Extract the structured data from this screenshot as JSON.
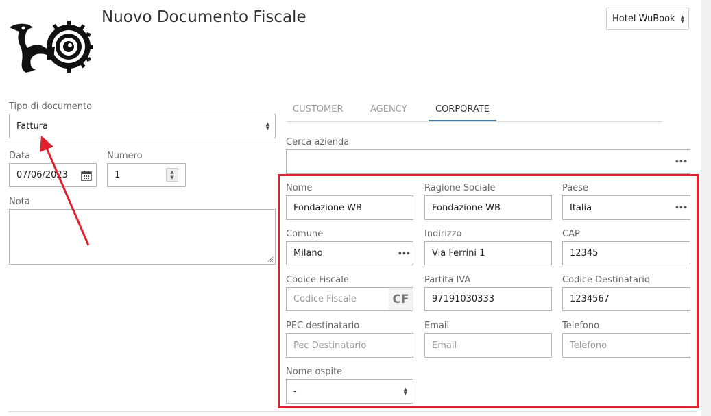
{
  "header": {
    "title": "Nuovo Documento Fiscale",
    "hotel_select": "Hotel WuBook"
  },
  "left": {
    "tipo_label": "Tipo di documento",
    "tipo_value": "Fattura",
    "data_label": "Data",
    "data_value": "07/06/2023",
    "numero_label": "Numero",
    "numero_value": "1",
    "nota_label": "Nota"
  },
  "tabs": [
    "CUSTOMER",
    "AGENCY",
    "CORPORATE"
  ],
  "active_tab": "CORPORATE",
  "search": {
    "label": "Cerca azienda"
  },
  "form": {
    "nome_label": "Nome",
    "nome_value": "Fondazione WB",
    "ragione_label": "Ragione Sociale",
    "ragione_value": "Fondazione WB",
    "paese_label": "Paese",
    "paese_value": "Italia",
    "comune_label": "Comune",
    "comune_value": "Milano",
    "indirizzo_label": "Indirizzo",
    "indirizzo_value": "Via Ferrini 1",
    "cap_label": "CAP",
    "cap_value": "12345",
    "cf_label": "Codice Fiscale",
    "cf_placeholder": "Codice Fiscale",
    "cf_button": "CF",
    "piva_label": "Partita IVA",
    "piva_value": "97191030333",
    "coddest_label": "Codice Destinatario",
    "coddest_value": "1234567",
    "pec_label": "PEC destinatario",
    "pec_placeholder": "Pec Destinatario",
    "email_label": "Email",
    "email_placeholder": "Email",
    "tel_label": "Telefono",
    "tel_placeholder": "Telefono",
    "ospite_label": "Nome ospite",
    "ospite_value": "-"
  },
  "colors": {
    "highlight": "#e0202c",
    "tab_active_underline": "#4a7ba6"
  }
}
